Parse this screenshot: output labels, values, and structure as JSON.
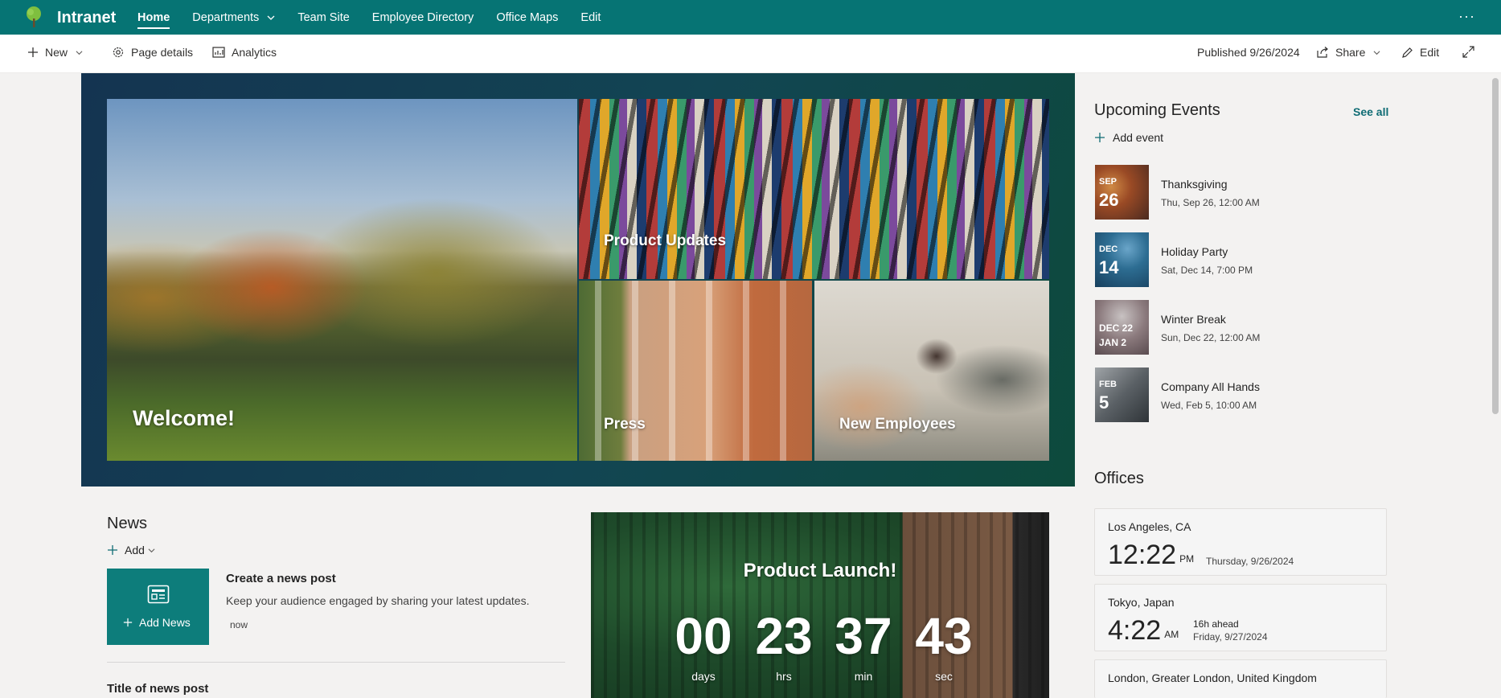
{
  "suite": {
    "site_title": "Intranet",
    "nav": [
      {
        "label": "Home",
        "active": true
      },
      {
        "label": "Departments",
        "has_menu": true
      },
      {
        "label": "Team Site"
      },
      {
        "label": "Employee Directory"
      },
      {
        "label": "Office Maps"
      },
      {
        "label": "Edit"
      }
    ],
    "more_icon": "ellipsis-icon"
  },
  "commandbar": {
    "new_label": "New",
    "page_details_label": "Page details",
    "analytics_label": "Analytics",
    "published_label": "Published 9/26/2024",
    "share_label": "Share",
    "edit_label": "Edit"
  },
  "hero": {
    "tiles": [
      {
        "label": "Welcome!"
      },
      {
        "label": "Product Updates"
      },
      {
        "label": "Press"
      },
      {
        "label": "New Employees"
      }
    ]
  },
  "events": {
    "title": "Upcoming Events",
    "see_all": "See all",
    "add_label": "Add event",
    "items": [
      {
        "month": "SEP",
        "day": "26",
        "title": "Thanksgiving",
        "when": "Thu, Sep 26, 12:00 AM"
      },
      {
        "month": "DEC",
        "day": "14",
        "title": "Holiday Party",
        "when": "Sat, Dec 14, 7:00 PM"
      },
      {
        "range_start": "DEC 22",
        "range_end": "JAN 2",
        "title": "Winter Break",
        "when": "Sun, Dec 22, 12:00 AM"
      },
      {
        "month": "FEB",
        "day": "5",
        "title": "Company All Hands",
        "when": "Wed, Feb 5, 10:00 AM"
      }
    ]
  },
  "offices": {
    "title": "Offices",
    "items": [
      {
        "city": "Los Angeles, CA",
        "time": "12:22",
        "ampm": "PM",
        "date": "Thursday, 9/26/2024"
      },
      {
        "city": "Tokyo, Japan",
        "time": "4:22",
        "ampm": "AM",
        "ahead": "16h ahead",
        "date": "Friday, 9/27/2024"
      },
      {
        "city": "London, Greater London, United Kingdom"
      }
    ]
  },
  "news": {
    "title": "News",
    "add_label": "Add",
    "card_label": "Add News",
    "create_title": "Create a news post",
    "create_desc": "Keep your audience engaged by sharing your latest updates.",
    "create_time": "now",
    "post_title": "Title of news post"
  },
  "countdown": {
    "title": "Product Launch!",
    "days": "00",
    "days_label": "days",
    "hrs": "23",
    "hrs_label": "hrs",
    "min": "37",
    "min_label": "min",
    "sec": "43",
    "sec_label": "sec"
  }
}
